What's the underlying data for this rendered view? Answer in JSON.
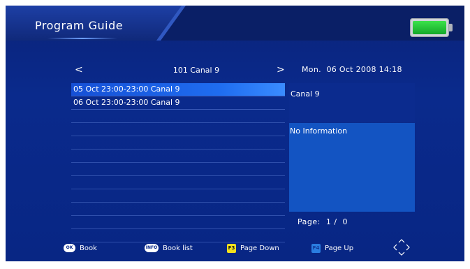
{
  "header": {
    "title": "Program Guide",
    "battery_color": "#22c23a"
  },
  "channel_bar": {
    "prev_icon": "chevron-left-icon",
    "next_icon": "chevron-right-icon",
    "prev_glyph": "<",
    "next_glyph": ">",
    "channel": "101 Canal 9",
    "datetime": "Mon.  06 Oct 2008 14:18"
  },
  "program_list": {
    "items": [
      "05 Oct 23:00-23:00  Canal 9",
      "06 Oct 23:00-23:00  Canal 9",
      "",
      "",
      "",
      "",
      "",
      "",
      "",
      "",
      "",
      ""
    ],
    "selected_index": 0
  },
  "info_panel": {
    "channel": "Canal 9",
    "description": "No Information",
    "page": "Page:  1 /  0"
  },
  "footer": {
    "ok_key": "OK",
    "book": "Book",
    "info_key": "INFO",
    "book_list": "Book list",
    "f3_key": "F3",
    "page_down": "Page Down",
    "f4_key": "F4",
    "page_up": "Page Up",
    "dpad_icon": "dpad-icon"
  },
  "colors": {
    "background": "#0a2a8c",
    "selection": "#1f6df0",
    "info_box": "#1354c2"
  }
}
